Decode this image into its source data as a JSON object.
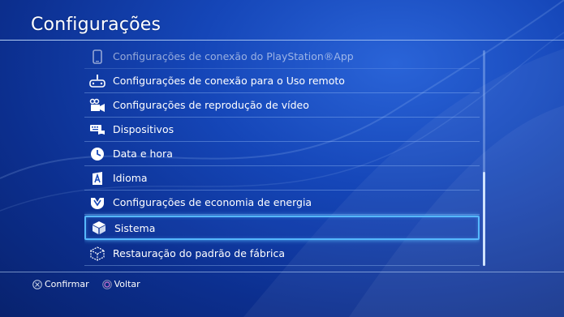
{
  "page": {
    "title": "Configurações"
  },
  "menu": {
    "items": [
      {
        "label": "Configurações de conexão do PlayStation®App",
        "icon": "phone-icon",
        "state": "faded"
      },
      {
        "label": "Configurações de conexão para o Uso remoto",
        "icon": "remote-play-icon",
        "state": "normal"
      },
      {
        "label": "Configurações de reprodução de vídeo",
        "icon": "film-icon",
        "state": "normal"
      },
      {
        "label": "Dispositivos",
        "icon": "keyboard-controller-icon",
        "state": "normal"
      },
      {
        "label": "Data e hora",
        "icon": "clock-icon",
        "state": "normal"
      },
      {
        "label": "Idioma",
        "icon": "language-icon",
        "state": "normal"
      },
      {
        "label": "Configurações de economia de energia",
        "icon": "power-saving-icon",
        "state": "normal"
      },
      {
        "label": "Sistema",
        "icon": "system-cube-icon",
        "state": "selected"
      },
      {
        "label": "Restauração do padrão de fábrica",
        "icon": "factory-reset-icon",
        "state": "normal"
      }
    ]
  },
  "footer": {
    "confirm_label": "Confirmar",
    "back_label": "Voltar"
  },
  "colors": {
    "accent": "#56b8ff",
    "cross": "#c9d3e6",
    "circle": "#d07ad0",
    "background": "#1546b8"
  }
}
